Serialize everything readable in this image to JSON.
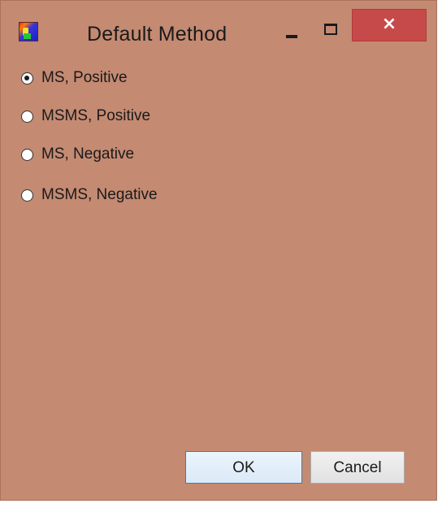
{
  "window": {
    "title": "Default Method",
    "controls": {
      "minimize_icon": "minimize-icon",
      "maximize_icon": "maximize-icon",
      "close_label": "×"
    },
    "frame_color": "#c48a72",
    "close_color": "#c64a4a"
  },
  "options": [
    {
      "label": "MS, Positive",
      "checked": true
    },
    {
      "label": "MSMS, Positive",
      "checked": false
    },
    {
      "label": "MS, Negative",
      "checked": false
    },
    {
      "label": "MSMS, Negative",
      "checked": false
    }
  ],
  "buttons": {
    "ok_label": "OK",
    "cancel_label": "Cancel"
  }
}
